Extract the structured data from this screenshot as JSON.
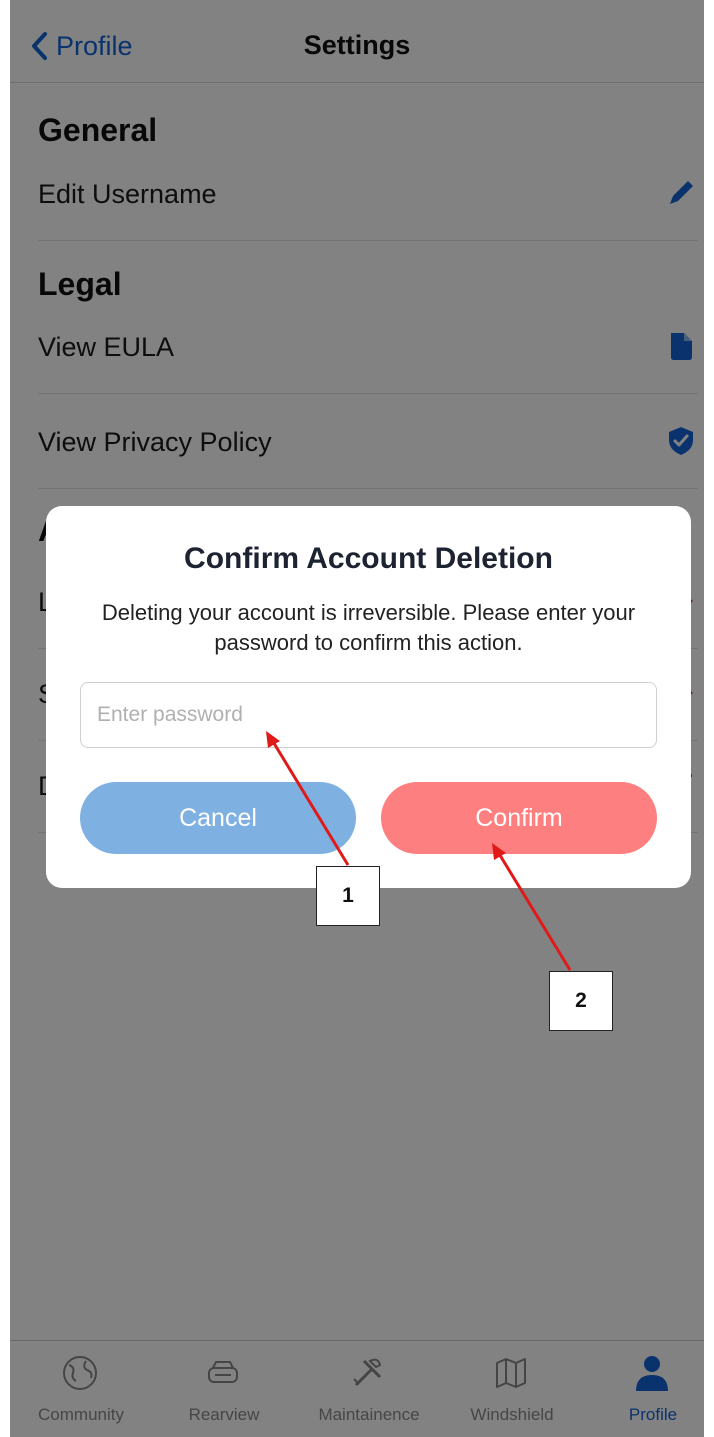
{
  "header": {
    "back_label": "Profile",
    "title": "Settings"
  },
  "sections": {
    "general": "General",
    "legal": "Legal",
    "account_partial": "A"
  },
  "rows": {
    "edit_username": "Edit Username",
    "view_eula": "View EULA",
    "view_privacy": "View Privacy Policy",
    "row_l": "L",
    "row_s": "S",
    "row_d": "D"
  },
  "dialog": {
    "title": "Confirm Account Deletion",
    "message": "Deleting your account is irreversible. Please enter your password to confirm this action.",
    "password_placeholder": "Enter password",
    "password_value": "",
    "cancel_label": "Cancel",
    "confirm_label": "Confirm"
  },
  "tabs": [
    {
      "label": "Community",
      "icon": "globe-icon"
    },
    {
      "label": "Rearview",
      "icon": "car-icon"
    },
    {
      "label": "Maintainence",
      "icon": "tools-icon"
    },
    {
      "label": "Windshield",
      "icon": "map-icon"
    },
    {
      "label": "Profile",
      "icon": "person-icon"
    }
  ],
  "annotations": {
    "badge_1": "1",
    "badge_2": "2"
  },
  "colors": {
    "accent_blue": "#1565d8",
    "cancel_button": "#7eb1e2",
    "confirm_button": "#fe7f7f",
    "annotation_arrow": "#e01919",
    "destructive_red": "#e53935"
  }
}
